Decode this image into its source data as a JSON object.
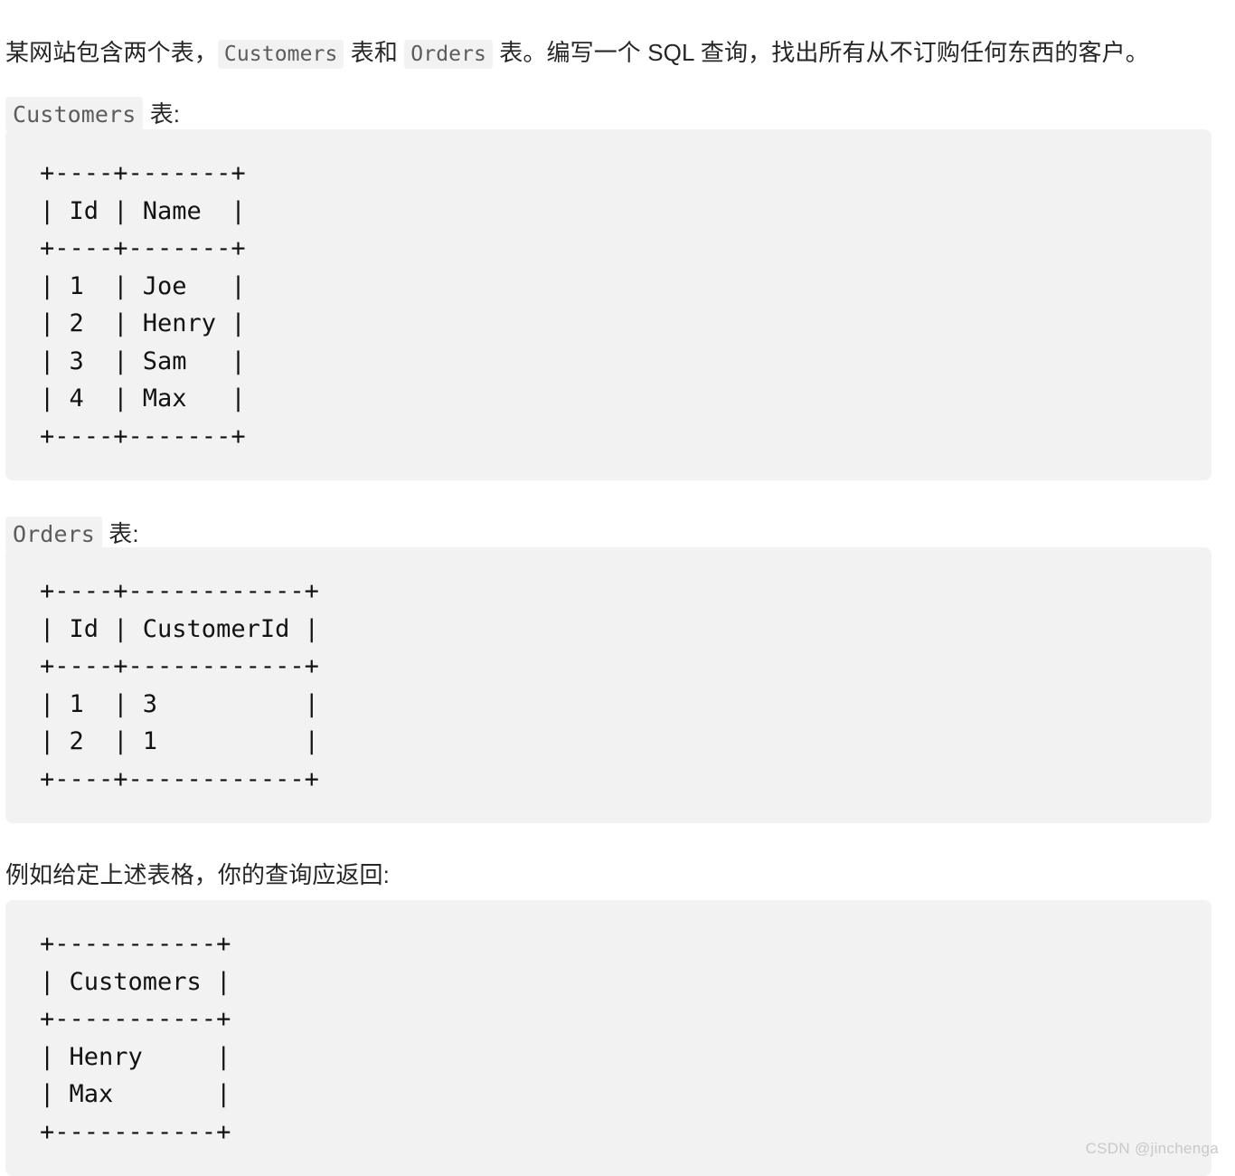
{
  "document": {
    "intro": {
      "before_code1": "某网站包含两个表，",
      "code1": "Customers",
      "between_codes": " 表和 ",
      "code2": "Orders",
      "after_code2": " 表。编写一个 SQL 查询，找出所有从不订购任何东西的客户。"
    },
    "label_customers": {
      "code": "Customers",
      "suffix": " 表:"
    },
    "label_orders": {
      "code": "Orders",
      "suffix": " 表:"
    },
    "example_line": "例如给定上述表格，你的查询应返回:"
  },
  "code_blocks": {
    "customers_table": {
      "columns": [
        "Id",
        "Name"
      ],
      "rows": [
        [
          "1",
          "Joe"
        ],
        [
          "2",
          "Henry"
        ],
        [
          "3",
          "Sam"
        ],
        [
          "4",
          "Max"
        ]
      ],
      "text": "+----+-------+\n| Id | Name  |\n+----+-------+\n| 1  | Joe   |\n| 2  | Henry |\n| 3  | Sam   |\n| 4  | Max   |\n+----+-------+"
    },
    "orders_table": {
      "columns": [
        "Id",
        "CustomerId"
      ],
      "rows": [
        [
          "1",
          "3"
        ],
        [
          "2",
          "1"
        ]
      ],
      "text": "+----+------------+\n| Id | CustomerId |\n+----+------------+\n| 1  | 3          |\n| 2  | 1          |\n+----+------------+"
    },
    "result_table": {
      "columns": [
        "Customers"
      ],
      "rows": [
        [
          "Henry"
        ],
        [
          "Max"
        ]
      ],
      "text": "+-----------+\n| Customers |\n+-----------+\n| Henry     |\n| Max       |\n+-----------+"
    }
  },
  "watermark": {
    "text": "CSDN @jinchenga"
  },
  "colors": {
    "page_background": "#ffffff",
    "code_block_background": "#f2f2f2",
    "inline_code_background": "#f2f2f2",
    "inline_code_text": "#5c5c5c",
    "body_text": "#262626",
    "code_text": "#121212",
    "watermark_text": "#c9c9c9"
  }
}
